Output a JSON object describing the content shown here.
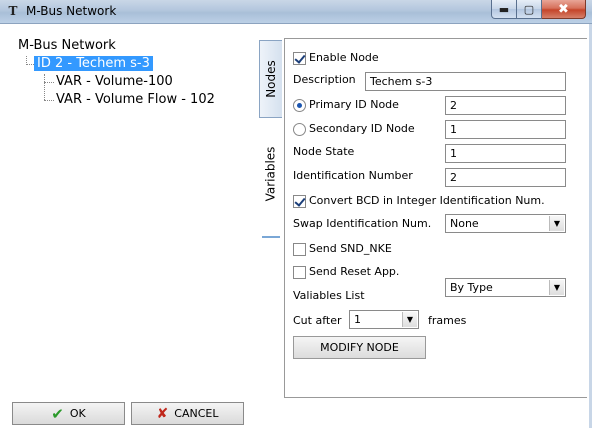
{
  "window": {
    "icon": "T",
    "title": "M-Bus Network",
    "controls": {
      "minimize": "minimize-icon",
      "maximize": "maximize-icon",
      "close": "close-icon"
    }
  },
  "tree": {
    "root": "M-Bus Network",
    "node": "ID 2 - Techem s-3",
    "children": [
      "VAR - Volume-100",
      "VAR - Volume Flow - 102"
    ]
  },
  "tabs": {
    "nodes": "Nodes",
    "variables": "Variables",
    "active": "Nodes"
  },
  "form": {
    "enable_node": {
      "label": "Enable Node",
      "checked": true
    },
    "description": {
      "label": "Description",
      "value": "Techem s-3"
    },
    "primary_id": {
      "label": "Primary ID Node",
      "value": "2",
      "selected": true
    },
    "secondary_id": {
      "label": "Secondary ID Node",
      "value": "1",
      "selected": false
    },
    "node_state": {
      "label": "Node State",
      "value": "1"
    },
    "identification_number": {
      "label": "Identification Number",
      "value": "2"
    },
    "convert_bcd": {
      "label": "Convert BCD in Integer Identification Num.",
      "checked": true
    },
    "swap_identification": {
      "label": "Swap Identification Num.",
      "value": "None"
    },
    "send_snd_nke": {
      "label": "Send SND_NKE",
      "checked": false
    },
    "send_reset_app": {
      "label": "Send Reset App.",
      "checked": false
    },
    "variables_list": {
      "label": "Valiables List",
      "value": "By Type"
    },
    "cut_after": {
      "label": "Cut after",
      "value": "1",
      "suffix": "frames"
    },
    "modify_button": "MODIFY NODE"
  },
  "buttons": {
    "ok": "OK",
    "cancel": "CANCEL"
  },
  "colors": {
    "selection": "#3399ff",
    "ok_icon": "#2a9a2a",
    "cancel_icon": "#c0271b"
  }
}
